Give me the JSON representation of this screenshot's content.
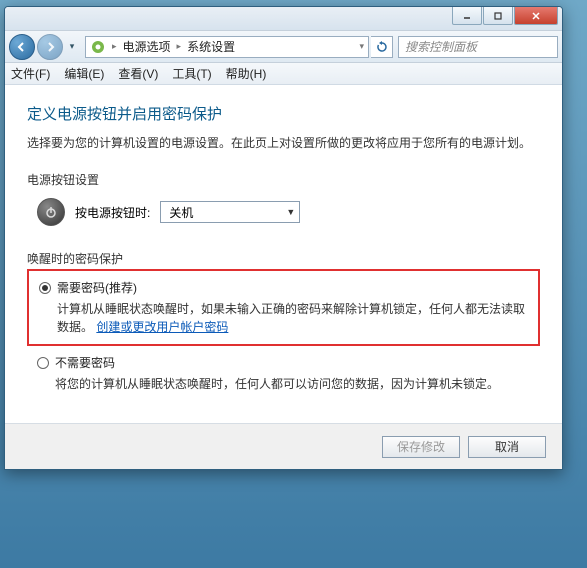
{
  "titlebar": {},
  "nav": {
    "crumb1": "电源选项",
    "crumb2": "系统设置",
    "search_placeholder": "搜索控制面板"
  },
  "menu": {
    "file": "文件(F)",
    "edit": "编辑(E)",
    "view": "查看(V)",
    "tools": "工具(T)",
    "help": "帮助(H)"
  },
  "page": {
    "heading": "定义电源按钮并启用密码保护",
    "subtext": "选择要为您的计算机设置的电源设置。在此页上对设置所做的更改将应用于您所有的电源计划。",
    "power_section_label": "电源按钮设置",
    "power_label": "按电源按钮时:",
    "power_value": "关机",
    "wake_section_label": "唤醒时的密码保护",
    "opt1_title": "需要密码(推荐)",
    "opt1_desc_a": "计算机从睡眠状态唤醒时，如果未输入正确的密码来解除计算机锁定，任何人都无法读取数据。",
    "opt1_link": "创建或更改用户帐户密码",
    "opt2_title": "不需要密码",
    "opt2_desc": "将您的计算机从睡眠状态唤醒时，任何人都可以访问您的数据，因为计算机未锁定。"
  },
  "footer": {
    "save": "保存修改",
    "cancel": "取消"
  }
}
